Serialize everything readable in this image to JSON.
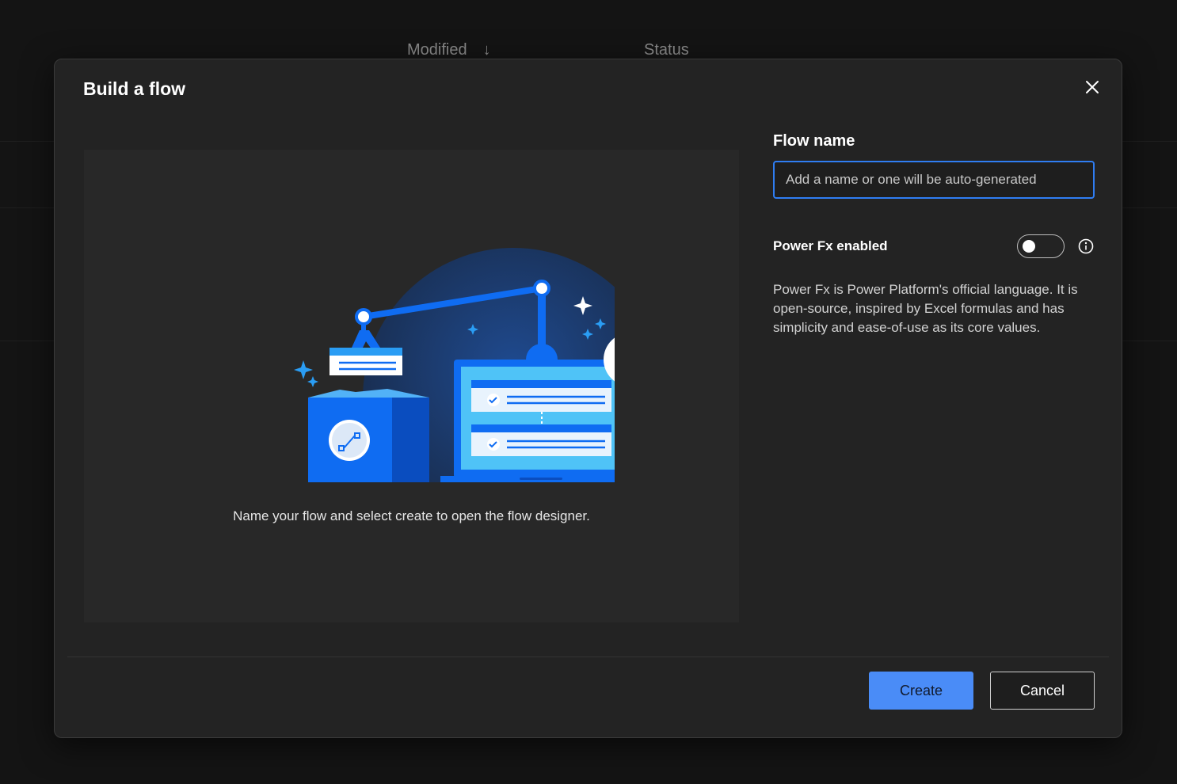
{
  "background": {
    "columns": [
      {
        "label": "Modified",
        "sort_icon": "arrow-down-icon",
        "sort_glyph": "↓"
      },
      {
        "label": "Status"
      }
    ]
  },
  "dialog": {
    "title": "Build a flow",
    "close_icon": "close-icon",
    "illustration": {
      "caption": "Name your flow and select create to open the flow designer."
    },
    "flow_name": {
      "label": "Flow name",
      "value": "",
      "placeholder": "Add a name or one will be auto-generated"
    },
    "power_fx": {
      "label": "Power Fx enabled",
      "enabled": false,
      "info_icon": "info-icon",
      "description": "Power Fx is Power Platform's official language. It is open-source, inspired by Excel formulas and has simplicity and ease-of-use as its core values."
    },
    "buttons": {
      "create": "Create",
      "cancel": "Cancel"
    }
  },
  "colors": {
    "accent": "#4a8cf7",
    "input_border": "#2f7df2",
    "dialog_bg": "#232323",
    "page_bg": "#141414"
  }
}
